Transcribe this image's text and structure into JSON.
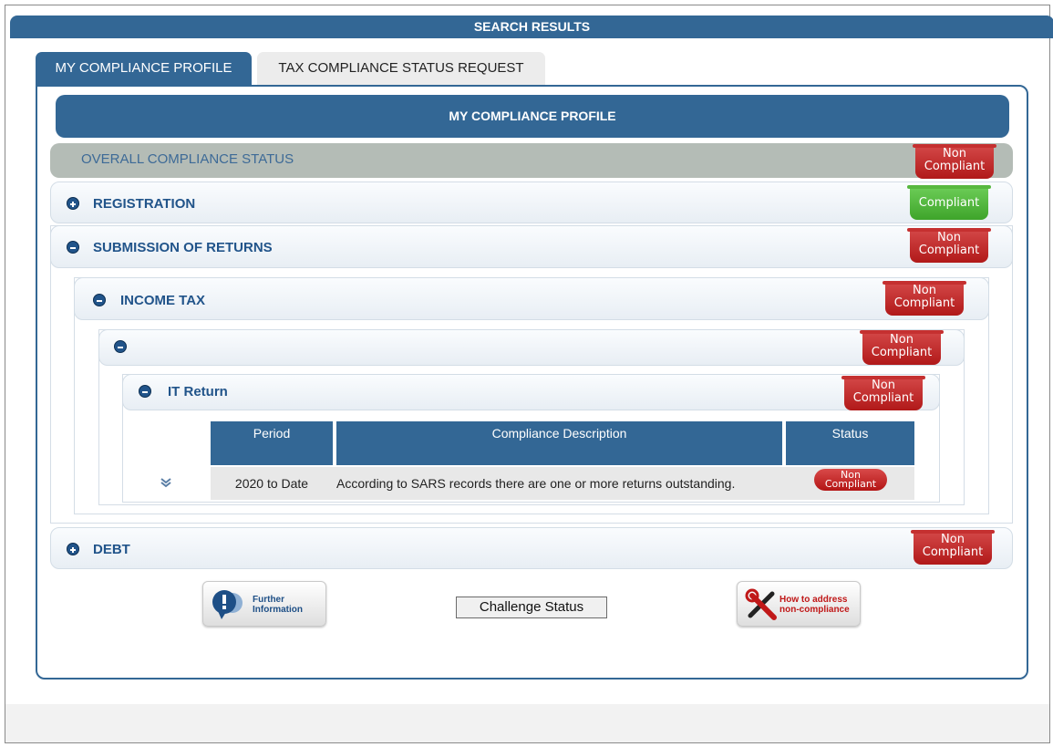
{
  "search_header": "SEARCH RESULTS",
  "tabs": [
    {
      "label": "MY COMPLIANCE PROFILE",
      "active": true
    },
    {
      "label": "TAX COMPLIANCE STATUS REQUEST",
      "active": false
    }
  ],
  "profile_header": "MY COMPLIANCE PROFILE",
  "overall": {
    "label": "OVERALL COMPLIANCE STATUS",
    "status": [
      "Non",
      "Compliant"
    ]
  },
  "sections": {
    "registration": {
      "label": "REGISTRATION",
      "status": "Compliant"
    },
    "submission": {
      "label": "SUBMISSION OF RETURNS",
      "status": [
        "Non",
        "Compliant"
      ]
    },
    "income_tax": {
      "label": "INCOME TAX",
      "status": [
        "Non",
        "Compliant"
      ]
    },
    "unnamed": {
      "label": "",
      "status": [
        "Non",
        "Compliant"
      ]
    },
    "it_return": {
      "label": "IT Return",
      "status": [
        "Non",
        "Compliant"
      ]
    },
    "debt": {
      "label": "DEBT",
      "status": [
        "Non",
        "Compliant"
      ]
    }
  },
  "table": {
    "headers": [
      "Period",
      "Compliance Description",
      "Status"
    ],
    "rows": [
      {
        "period": "2020 to Date",
        "description": "According to SARS records there are one or more returns outstanding.",
        "status": [
          "Non",
          "Compliant"
        ]
      }
    ]
  },
  "buttons": {
    "further_info": [
      "Further",
      "Information"
    ],
    "challenge": "Challenge Status",
    "how_to_address": [
      "How to address",
      "non-compliance"
    ]
  },
  "colors": {
    "primary": "#336795",
    "non_compliant": "#b11919",
    "compliant": "#3ea42a"
  }
}
